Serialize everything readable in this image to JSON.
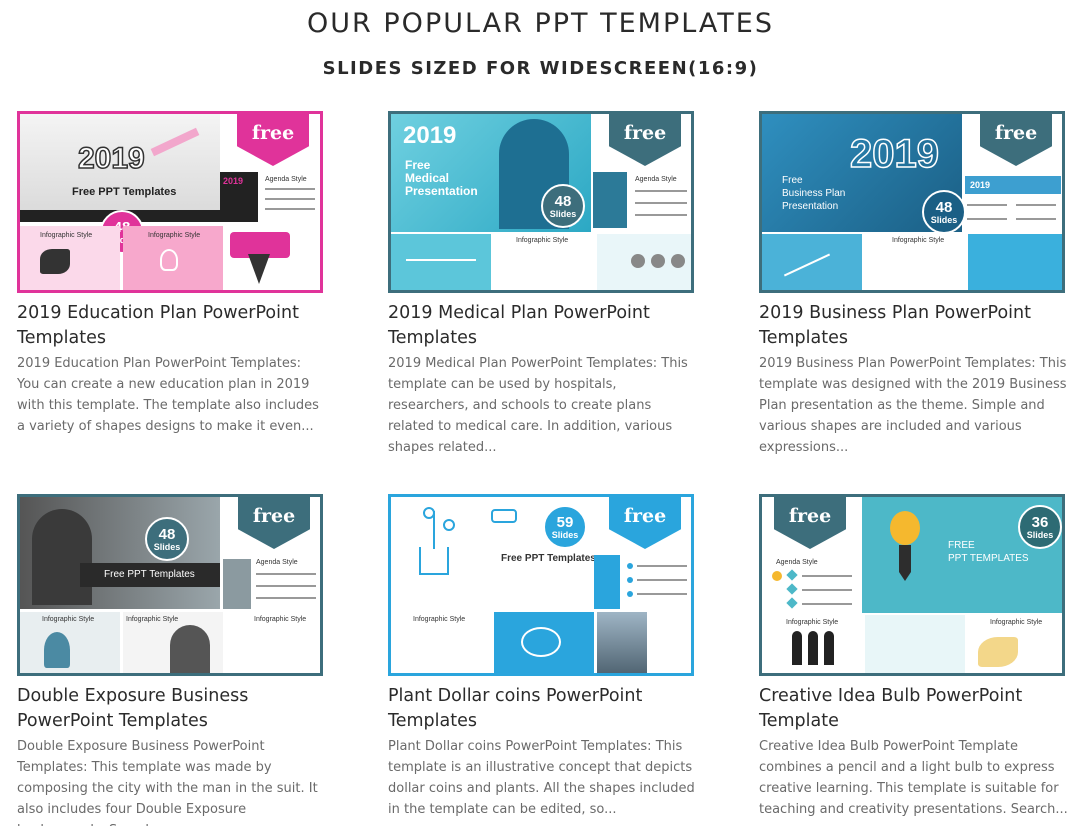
{
  "header": {
    "title": "OUR POPULAR PPT TEMPLATES",
    "subtitle": "SLIDES SIZED FOR WIDESCREEN(16:9)"
  },
  "colors": {
    "pink_border": "#e0339a",
    "teal_border": "#3d6e7c",
    "blue_border": "#2aa5dd",
    "ribbon_pink": "#e0339a",
    "ribbon_teal": "#3d6e7c",
    "ribbon_blue": "#2aa5dd"
  },
  "thumb_labels": {
    "free": "free",
    "slides": "Slides",
    "infographic_style": "Infographic Style",
    "agenda_style": "Agenda Style",
    "free_ppt_templates": "Free PPT Templates",
    "year": "2019",
    "free_medical": "Free\nMedical\nPresentation",
    "free_business": "Free\nBusiness Plan\nPresentation",
    "free_caps": "FREE\nPPT TEMPLATES"
  },
  "cards": [
    {
      "title": "2019 Education Plan PowerPoint Templates",
      "description": "2019 Education Plan PowerPoint Templates: You can create a new education plan in 2019 with this template. The template also includes a variety of shapes designs to make it even...",
      "slide_count": "48"
    },
    {
      "title": "2019 Medical Plan PowerPoint Templates",
      "description": "2019 Medical Plan PowerPoint Templates: This template can be used by hospitals, researchers, and schools to create plans related to medical care. In addition, various shapes related...",
      "slide_count": "48"
    },
    {
      "title": "2019 Business Plan PowerPoint Templates",
      "description": "2019 Business Plan PowerPoint Templates: This template was designed with the 2019 Business Plan presentation as the theme. Simple and various shapes are included and various expressions...",
      "slide_count": "48"
    },
    {
      "title": "Double Exposure Business PowerPoint Templates",
      "description": "Double Exposure Business PowerPoint Templates: This template was made by composing the city with the man in the suit. It also includes four Double Exposure backgrounds. Search...",
      "slide_count": "48"
    },
    {
      "title": "Plant Dollar coins PowerPoint Templates",
      "description": "Plant Dollar coins PowerPoint Templates: This template is an illustrative concept that depicts dollar coins and plants. All the shapes included in the template can be edited, so...",
      "slide_count": "59"
    },
    {
      "title": "Creative Idea Bulb PowerPoint Template",
      "description": "Creative Idea Bulb PowerPoint Template combines a pencil and a light bulb to express creative learning. This template is suitable for teaching and creativity presentations. Search...",
      "slide_count": "36"
    }
  ]
}
